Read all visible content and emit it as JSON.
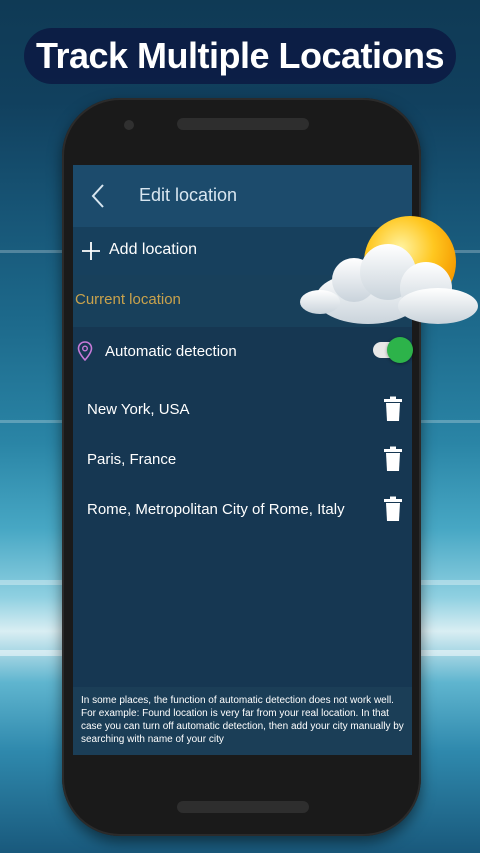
{
  "banner": {
    "title": "Track Multiple Locations"
  },
  "appbar": {
    "title": "Edit location",
    "back_icon": "chevron-left-icon"
  },
  "add_location": {
    "label": "Add location",
    "icon": "plus-icon"
  },
  "current_location": {
    "header": "Current location",
    "auto_detection": {
      "label": "Automatic detection",
      "icon": "location-pin-icon",
      "enabled": true
    }
  },
  "cities": [
    {
      "name": "New York, USA"
    },
    {
      "name": "Paris, France"
    },
    {
      "name": "Rome, Metropolitan City of Rome, Italy"
    }
  ],
  "note": {
    "text": "In some places, the function of automatic detection does not work well. For example: Found location is very far from your real location. In that case you can turn off automatic detection, then add your city manually by searching with name of your city"
  },
  "colors": {
    "section_header": "#c9a24c",
    "toggle_on": "#2db34a",
    "pin": "#c77ad9",
    "banner_bg": "#0c1640"
  }
}
